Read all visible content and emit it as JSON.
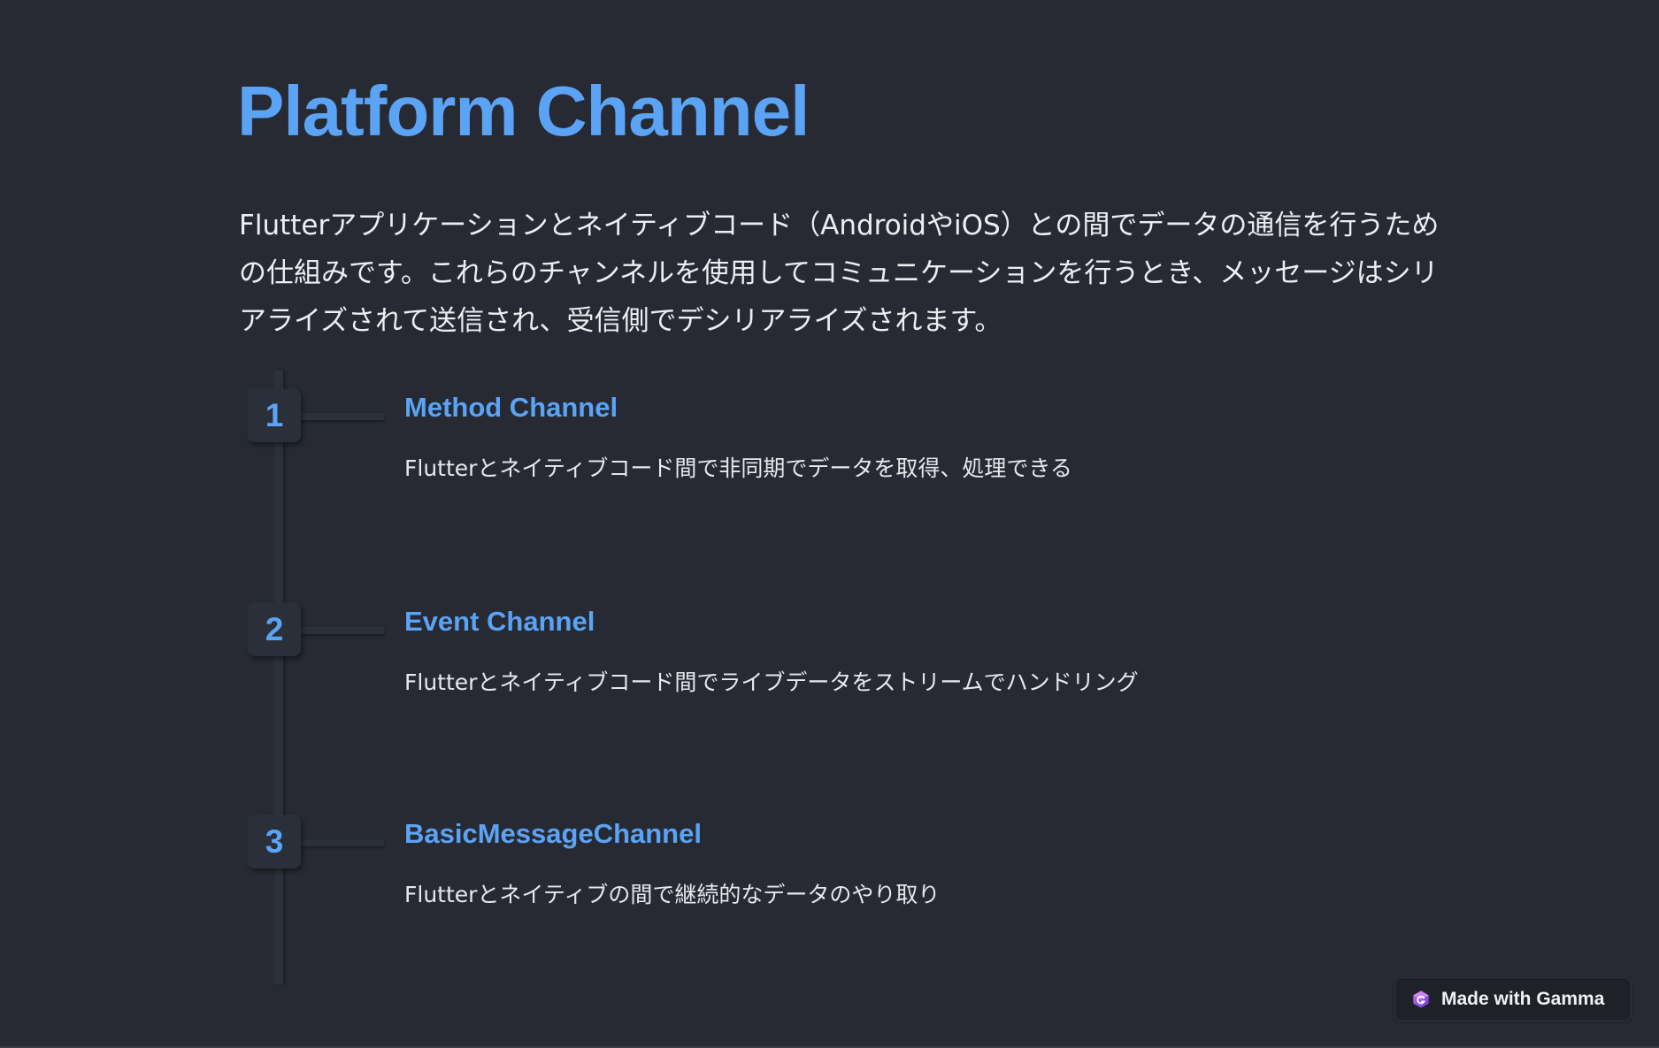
{
  "slide": {
    "title": "Platform Channel",
    "intro": "Flutterアプリケーションとネイティブコード（AndroidやiOS）との間でデータの通信を行うための仕組みです。これらのチャンネルを使用してコミュニケーションを行うとき、メッセージはシリアライズされて送信され、受信側でデシリアライズされます。",
    "steps": [
      {
        "number": "1",
        "title": "Method Channel",
        "description": "Flutterとネイティブコード間で非同期でデータを取得、処理できる"
      },
      {
        "number": "2",
        "title": "Event Channel",
        "description": "Flutterとネイティブコード間でライブデータをストリームでハンドリング"
      },
      {
        "number": "3",
        "title": "BasicMessageChannel",
        "description": "Flutterとネイティブの間で継続的なデータのやり取り"
      }
    ]
  },
  "badge": {
    "label": "Made with Gamma",
    "icon": "gamma-logo-icon"
  },
  "colors": {
    "background": "#272a33",
    "accent": "#5ba3f5",
    "text": "#e6e8ec"
  }
}
